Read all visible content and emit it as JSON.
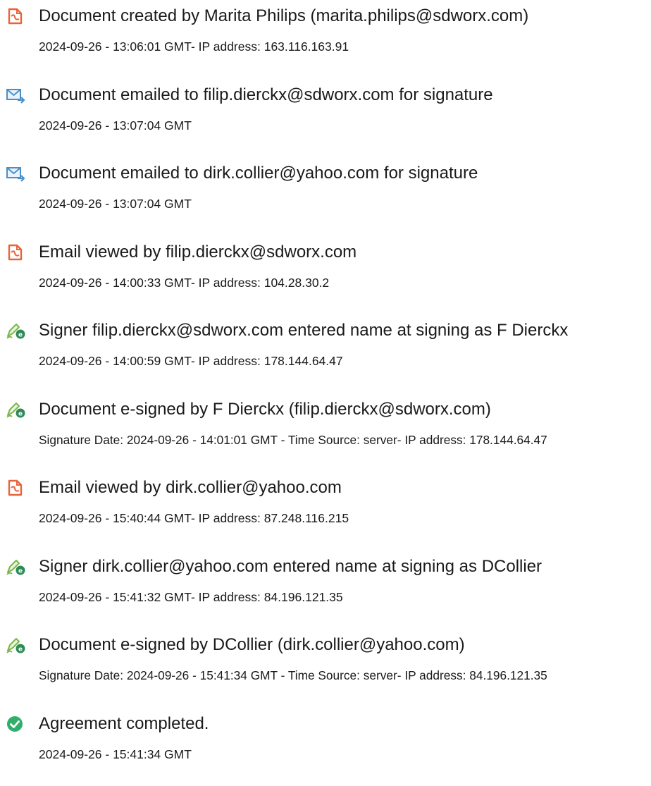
{
  "events": [
    {
      "icon": "document-icon",
      "title": "Document created by Marita Philips (marita.philips@sdworx.com)",
      "detail": "2024-09-26 - 13:06:01 GMT- IP address: 163.116.163.91"
    },
    {
      "icon": "email-sent-icon",
      "title": "Document emailed to filip.dierckx@sdworx.com for signature",
      "detail": "2024-09-26 - 13:07:04 GMT"
    },
    {
      "icon": "email-sent-icon",
      "title": "Document emailed to dirk.collier@yahoo.com for signature",
      "detail": "2024-09-26 - 13:07:04 GMT"
    },
    {
      "icon": "document-icon",
      "title": "Email viewed by filip.dierckx@sdworx.com",
      "detail": "2024-09-26 - 14:00:33 GMT- IP address: 104.28.30.2"
    },
    {
      "icon": "e-sign-icon",
      "title": "Signer filip.dierckx@sdworx.com entered name at signing as F Dierckx",
      "detail": "2024-09-26 - 14:00:59 GMT- IP address: 178.144.64.47"
    },
    {
      "icon": "e-sign-icon",
      "title": "Document e-signed by F Dierckx (filip.dierckx@sdworx.com)",
      "detail": "Signature Date: 2024-09-26 - 14:01:01 GMT - Time Source: server- IP address: 178.144.64.47"
    },
    {
      "icon": "document-icon",
      "title": "Email viewed by dirk.collier@yahoo.com",
      "detail": "2024-09-26 - 15:40:44 GMT- IP address: 87.248.116.215"
    },
    {
      "icon": "e-sign-icon",
      "title": "Signer dirk.collier@yahoo.com entered name at signing as DCollier",
      "detail": "2024-09-26 - 15:41:32 GMT- IP address: 84.196.121.35"
    },
    {
      "icon": "e-sign-icon",
      "title": "Document e-signed by DCollier (dirk.collier@yahoo.com)",
      "detail": "Signature Date: 2024-09-26 - 15:41:34 GMT - Time Source: server- IP address: 84.196.121.35"
    },
    {
      "icon": "checkmark-circle-icon",
      "title": "Agreement completed.",
      "detail": "2024-09-26 - 15:41:34 GMT"
    }
  ],
  "colors": {
    "document_icon": "#e8643a",
    "email_icon": "#4a90c8",
    "esign_pen": "#7ab648",
    "esign_badge": "#2e8b57",
    "check": "#2eaf6a"
  }
}
